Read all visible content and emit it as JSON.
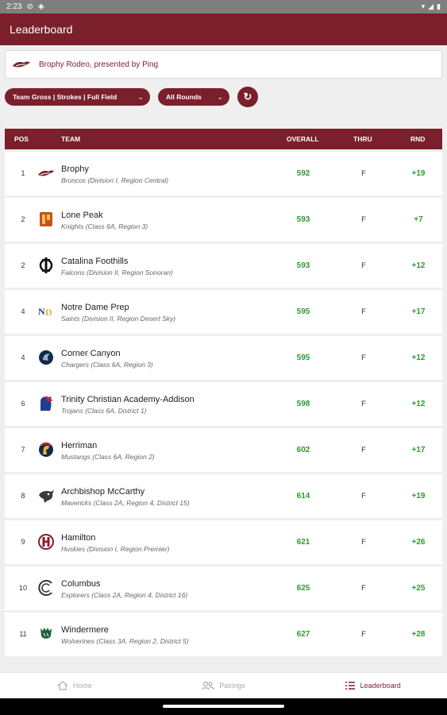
{
  "status": {
    "time": "2:23",
    "battery": "▮"
  },
  "app_bar": {
    "title": "Leaderboard"
  },
  "event": {
    "name": "Brophy Rodeo, presented by Ping"
  },
  "filters": {
    "scoring": "Team Gross | Strokes | Full Field",
    "rounds": "All Rounds"
  },
  "table": {
    "headers": {
      "pos": "POS",
      "team": "TEAM",
      "overall": "OVERALL",
      "thru": "THRU",
      "rnd": "RND"
    },
    "rows": [
      {
        "pos": "1",
        "team": "Brophy",
        "sub": "Broncos (Division I, Region Central)",
        "overall": "592",
        "thru": "F",
        "rnd": "+19",
        "logo": "bronco-logo-icon"
      },
      {
        "pos": "2",
        "team": "Lone Peak",
        "sub": "Knights (Class 6A, Region 3)",
        "overall": "593",
        "thru": "F",
        "rnd": "+7",
        "logo": "lp-logo-icon"
      },
      {
        "pos": "2",
        "team": "Catalina Foothills",
        "sub": "Falcons (Division II, Region Sonoran)",
        "overall": "593",
        "thru": "F",
        "rnd": "+12",
        "logo": "cf-logo-icon"
      },
      {
        "pos": "4",
        "team": "Notre Dame Prep",
        "sub": "Saints (Division II, Region Desert Sky)",
        "overall": "595",
        "thru": "F",
        "rnd": "+17",
        "logo": "ndp-logo-icon"
      },
      {
        "pos": "4",
        "team": "Corner Canyon",
        "sub": "Chargers (Class 6A, Region 3)",
        "overall": "595",
        "thru": "F",
        "rnd": "+12",
        "logo": "charger-logo-icon"
      },
      {
        "pos": "6",
        "team": "Trinity Christian Academy-Addison",
        "sub": "Trojans (Class 6A, District 1)",
        "overall": "598",
        "thru": "F",
        "rnd": "+12",
        "logo": "trojan-logo-icon"
      },
      {
        "pos": "7",
        "team": "Herriman",
        "sub": "Mustangs (Class 6A, Region 2)",
        "overall": "602",
        "thru": "F",
        "rnd": "+17",
        "logo": "mustang-logo-icon"
      },
      {
        "pos": "8",
        "team": "Archbishop McCarthy",
        "sub": "Mavericks (Class 2A, Region 4, District 15)",
        "overall": "614",
        "thru": "F",
        "rnd": "+19",
        "logo": "maverick-logo-icon"
      },
      {
        "pos": "9",
        "team": "Hamilton",
        "sub": "Huskies (Division I, Region Premier)",
        "overall": "621",
        "thru": "F",
        "rnd": "+26",
        "logo": "husky-logo-icon"
      },
      {
        "pos": "10",
        "team": "Columbus",
        "sub": "Explorers (Class 2A, Region 4, District 16)",
        "overall": "625",
        "thru": "F",
        "rnd": "+25",
        "logo": "columbus-logo-icon"
      },
      {
        "pos": "11",
        "team": "Windermere",
        "sub": "Wolverines (Class 3A, Region 2, District 5)",
        "overall": "627",
        "thru": "F",
        "rnd": "+28",
        "logo": "wolverine-logo-icon"
      }
    ]
  },
  "nav": {
    "home": "Home",
    "pairings": "Pairings",
    "leaderboard": "Leaderboard"
  },
  "colors": {
    "brand": "#7a1f2b",
    "positive": "#2e9a2e"
  }
}
